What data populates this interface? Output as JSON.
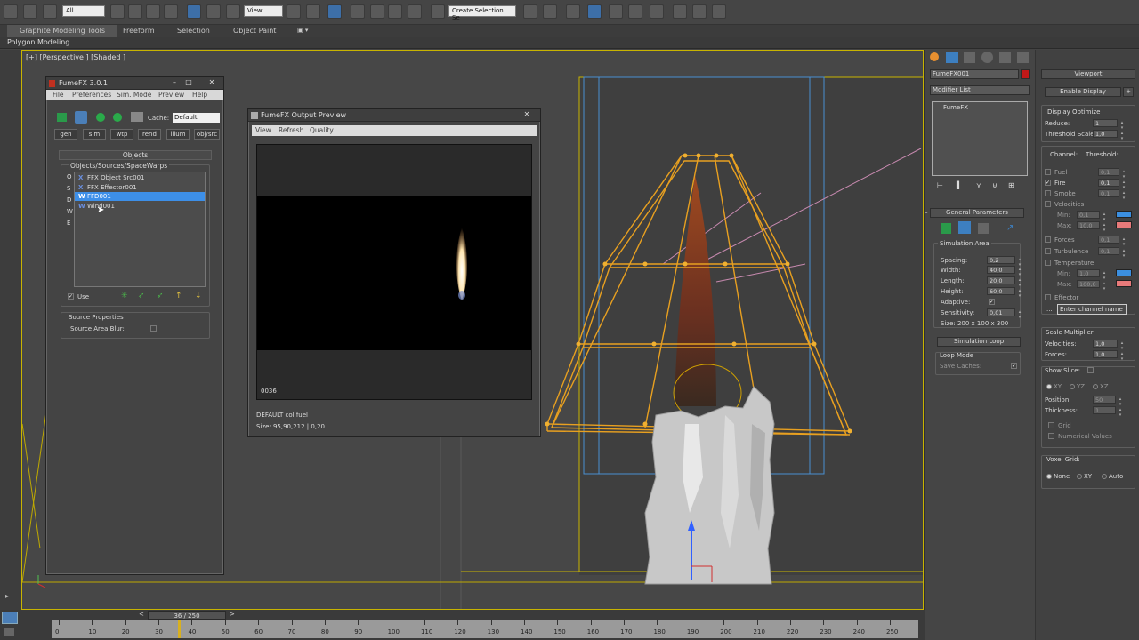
{
  "toolbar": {
    "selection_filter": "All",
    "ref_coord": "View",
    "named_selection": "Create Selection Se"
  },
  "ribbon": {
    "tabs": [
      "Graphite Modeling Tools",
      "Freeform",
      "Selection",
      "Object Paint"
    ],
    "sub_tab": "Polygon Modeling"
  },
  "viewport": {
    "label": "[+] [Perspective ] [Shaded ]"
  },
  "fumefx_window": {
    "title": "FumeFX 3.0.1",
    "menu": [
      "File",
      "Preferences",
      "Sim. Mode",
      "Preview",
      "Help"
    ],
    "cache_label": "Cache:",
    "cache_value": "Default",
    "tabs": [
      "gen",
      "sim",
      "wtp",
      "rend",
      "illum",
      "obj/src"
    ],
    "objects_rollout": "Objects",
    "list_group": "Objects/Sources/SpaceWarps",
    "side_letters": [
      "O",
      "S",
      "D",
      "W",
      "E"
    ],
    "items": [
      {
        "label": "FFX Object Src001",
        "icon": "X",
        "selected": false
      },
      {
        "label": "FFX Effector001",
        "icon": "X",
        "selected": false
      },
      {
        "label": "FFD001",
        "icon": "W",
        "selected": true
      },
      {
        "label": "Wind001",
        "icon": "W",
        "selected": false
      }
    ],
    "use_label": "Use",
    "source_props_title": "Source Properties",
    "source_area_blur": "Source Area Blur:"
  },
  "preview_window": {
    "title": "FumeFX Output Preview",
    "menu": [
      "View",
      "Refresh",
      "Quality"
    ],
    "frame": "0036",
    "status_line1": "DEFAULT col fuel",
    "status_line2": "Size: 95,90,212 | 0,20"
  },
  "command_panel": {
    "object_name": "FumeFX001",
    "modifier_list": "Modifier List",
    "stack_item": "FumeFX",
    "general_params": "General Parameters",
    "sim_area": "Simulation Area",
    "spacing_label": "Spacing:",
    "spacing": "0,2",
    "width_label": "Width:",
    "width": "40,0",
    "length_label": "Length:",
    "length": "20,0",
    "height_label": "Height:",
    "height": "60,0",
    "adaptive_label": "Adaptive:",
    "sensitivity_label": "Sensitivity:",
    "sensitivity": "0,01",
    "size_text": "Size:  200 x 100 x 300",
    "sim_loop_btn": "Simulation Loop",
    "loop_mode": "Loop Mode",
    "save_caches": "Save Caches:"
  },
  "viewport_panel": {
    "title": "Viewport",
    "enable_display": "Enable Display",
    "display_optimize": "Display Optimize",
    "reduce_label": "Reduce:",
    "reduce": "1",
    "threshold_scale_label": "Threshold Scale:",
    "threshold_scale": "1,0",
    "channel_header": "Channel:",
    "threshold_header": "Threshold:",
    "fuel": "Fuel",
    "fuel_val": "0,1",
    "fire": "Fire",
    "fire_val": "0,1",
    "smoke": "Smoke",
    "smoke_val": "0,1",
    "velocities": "Velocities",
    "min_label": "Min:",
    "vel_min": "0,1",
    "max_label": "Max:",
    "vel_max": "10,0",
    "forces": "Forces",
    "forces_val": "0,1",
    "turbulence": "Turbulence",
    "turbulence_val": "0,1",
    "temperature": "Temperature",
    "temp_min": "1,0",
    "temp_max": "100,0",
    "effector": "Effector",
    "channel_name_placeholder": "Enter channel name",
    "scale_multiplier": "Scale Multiplier",
    "vel_mult_label": "Velocities:",
    "vel_mult": "1,0",
    "forces_mult_label": "Forces:",
    "forces_mult": "1,0",
    "show_slice": "Show Slice:",
    "axes": [
      "XY",
      "YZ",
      "XZ"
    ],
    "position_label": "Position:",
    "position": "50",
    "thickness_label": "Thickness:",
    "thickness": "1",
    "grid": "Grid",
    "numerical_values": "Numerical Values",
    "voxel_grid": "Voxel Grid:",
    "voxel_opts": [
      "None",
      "XY",
      "Auto"
    ],
    "colors": {
      "vel_min": "#3b8fe0",
      "vel_max": "#e87a7a",
      "temp_min": "#3b8fe0",
      "temp_max": "#e87a7a"
    }
  },
  "timeline": {
    "slider_text": "36 / 250",
    "ticks": [
      "0",
      "10",
      "20",
      "30",
      "40",
      "50",
      "60",
      "70",
      "80",
      "90",
      "100",
      "110",
      "120",
      "130",
      "140",
      "150",
      "160",
      "170",
      "180",
      "190",
      "200",
      "210",
      "220",
      "230",
      "240",
      "250"
    ]
  }
}
